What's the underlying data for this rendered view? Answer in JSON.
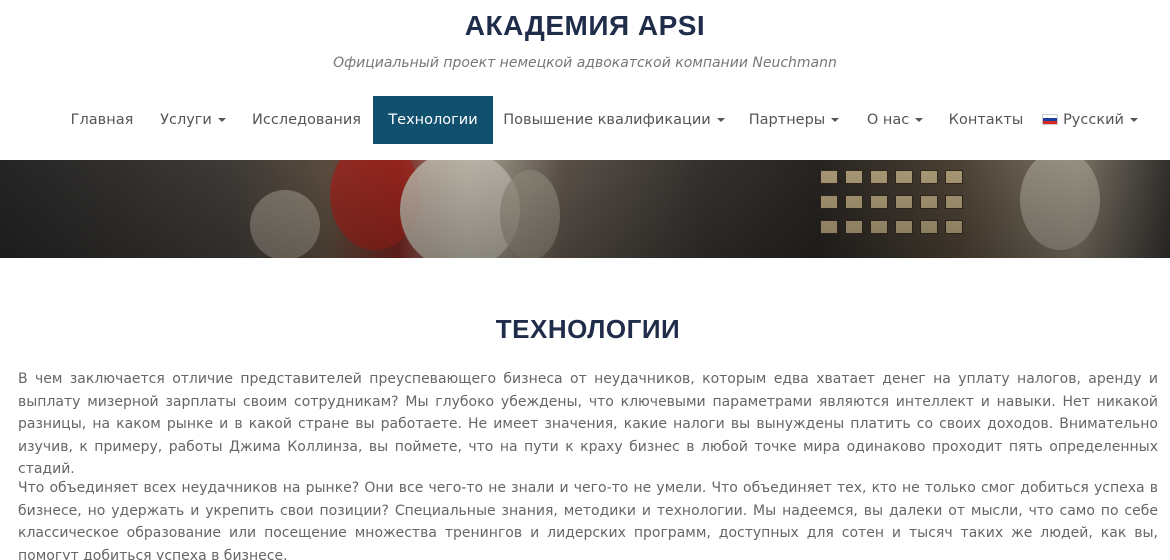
{
  "site": {
    "title": "АКАДЕМИЯ APSI",
    "tagline": "Официальный проект немецкой адвокатской компании Neuchmann"
  },
  "nav": {
    "items": [
      {
        "label": "Главная",
        "has_dropdown": false
      },
      {
        "label": "Услуги",
        "has_dropdown": true
      },
      {
        "label": "Исследования",
        "has_dropdown": false
      },
      {
        "label": "Технологии",
        "has_dropdown": false,
        "active": true
      },
      {
        "label": "Повышение квалификации",
        "has_dropdown": true
      },
      {
        "label": "Партнеры",
        "has_dropdown": true
      },
      {
        "label": "О нас",
        "has_dropdown": true
      },
      {
        "label": "Контакты",
        "has_dropdown": false
      },
      {
        "label": "Русский",
        "has_dropdown": true,
        "icon": "russia-flag-icon"
      }
    ],
    "active_color": "#11506e"
  },
  "main": {
    "title": "ТЕХНОЛОГИИ",
    "paragraphs": [
      "В чем заключается отличие представителей преуспевающего бизнеса от неудачников, которым едва хватает денег на уплату налогов, аренду и выплату мизерной зарплаты своим сотрудникам? Мы глубоко убеждены, что ключевыми параметрами являются интеллект и навыки. Нет никакой разницы, на каком рынке и в какой стране вы работаете. Не имеет значения, какие налоги вы вынуждены платить со своих доходов. Внимательно изучив, к примеру, работы Джима Коллинза, вы поймете, что на пути к краху бизнес в любой точке мира одинаково проходит пять определенных стадий.",
      "Что объединяет всех неудачников на рынке? Они все чего-то не знали и чего-то не умели. Что объединяет тех, кто не только смог добиться успеха в бизнесе, но удержать и укрепить свои позиции? Специальные знания, методики и технологии. Мы надеемся, вы далеки от мысли, что само по себе классическое образование или посещение множества тренингов и лидерских программ, доступных для сотен и тысяч таких же людей, как вы, помогут добиться успеха в бизнесе."
    ]
  },
  "colors": {
    "heading": "#1f2d4a",
    "body_text": "#666666"
  }
}
